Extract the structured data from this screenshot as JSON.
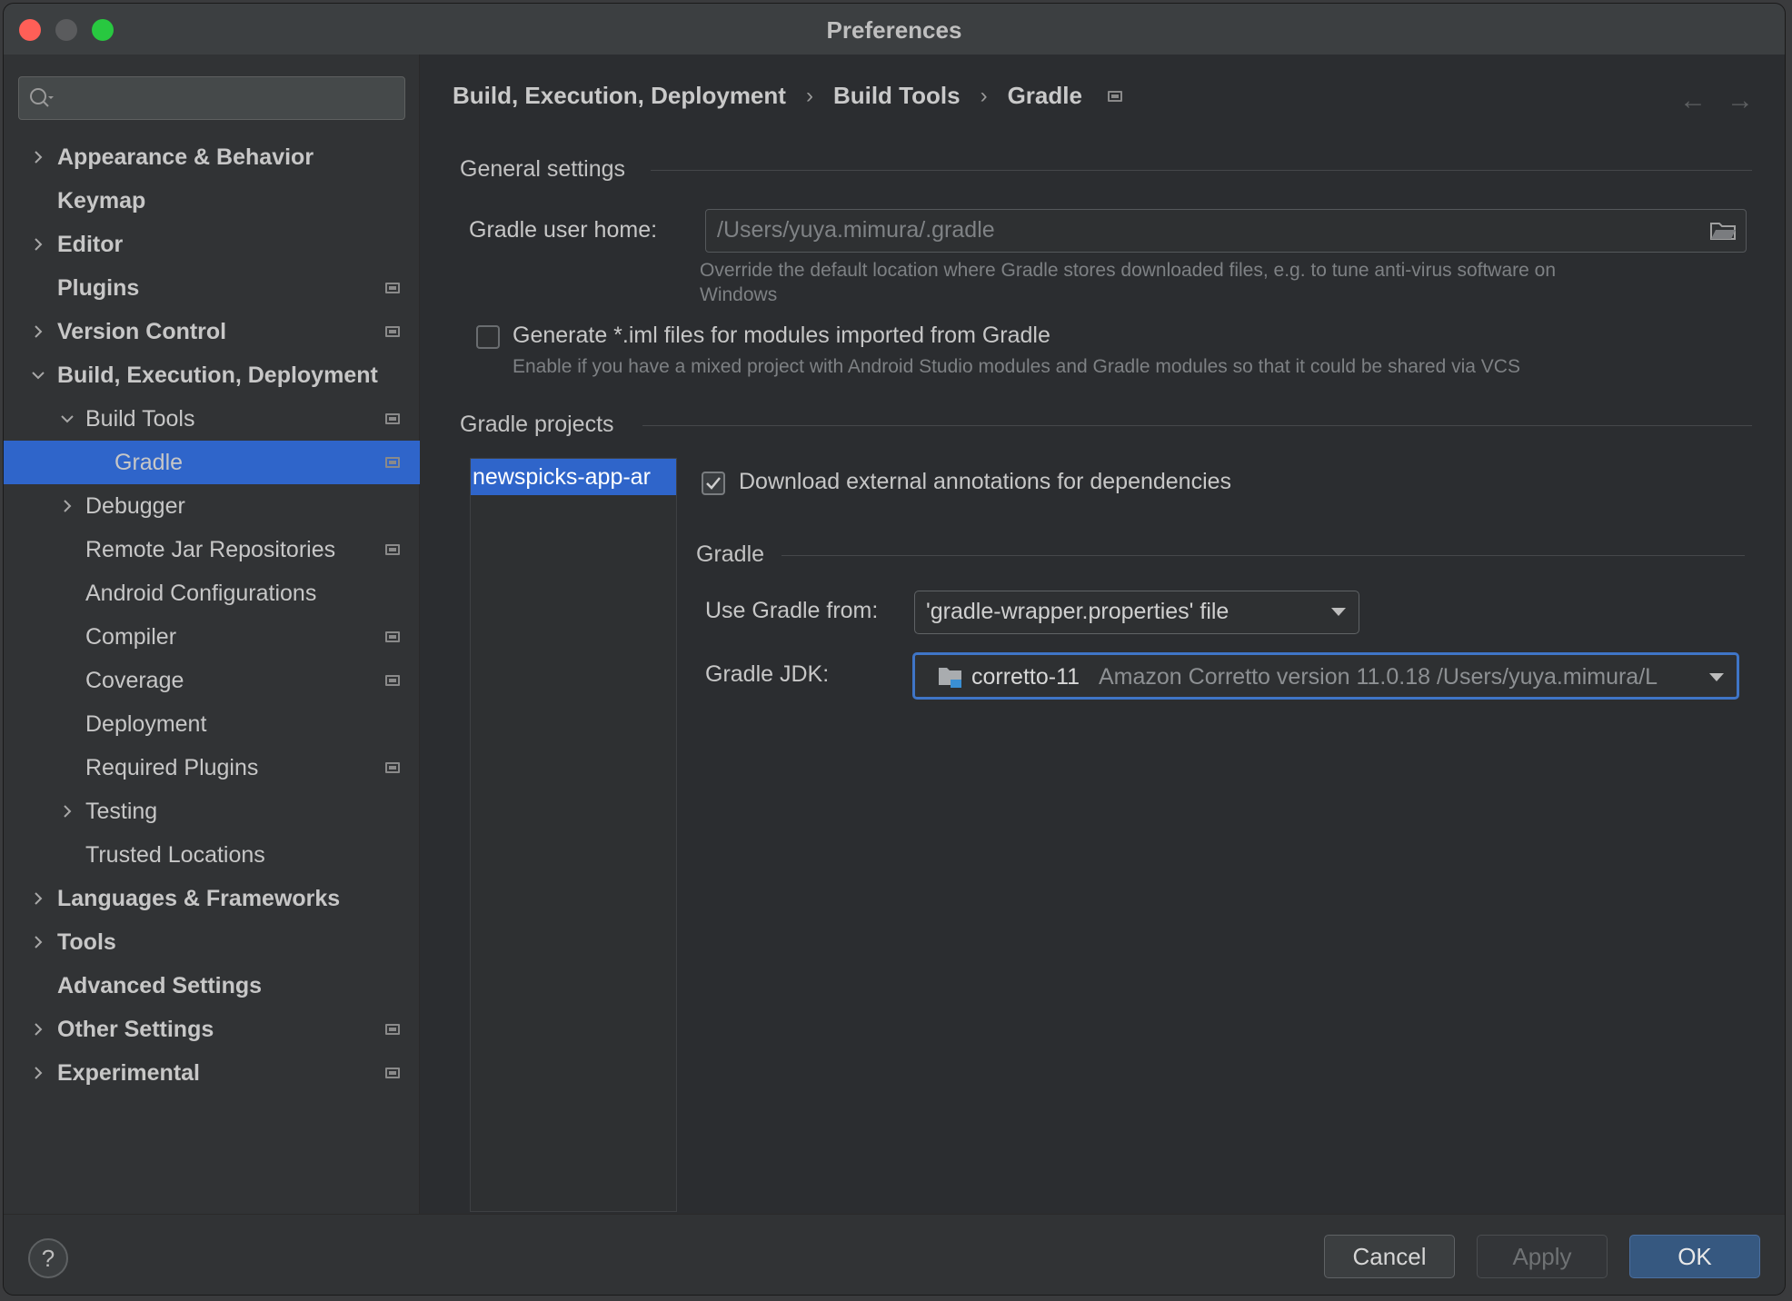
{
  "window": {
    "title": "Preferences"
  },
  "search": {
    "value": "",
    "placeholder": ""
  },
  "sidebar": {
    "items": [
      {
        "label": "Appearance & Behavior",
        "level": 0,
        "bold": true,
        "chevron": "right",
        "pin": false
      },
      {
        "label": "Keymap",
        "level": 0,
        "bold": true,
        "chevron": "none",
        "pin": false
      },
      {
        "label": "Editor",
        "level": 0,
        "bold": true,
        "chevron": "right",
        "pin": false
      },
      {
        "label": "Plugins",
        "level": 0,
        "bold": true,
        "chevron": "none",
        "pin": true
      },
      {
        "label": "Version Control",
        "level": 0,
        "bold": true,
        "chevron": "right",
        "pin": true
      },
      {
        "label": "Build, Execution, Deployment",
        "level": 0,
        "bold": true,
        "chevron": "down",
        "pin": false
      },
      {
        "label": "Build Tools",
        "level": 1,
        "bold": false,
        "chevron": "down",
        "pin": true
      },
      {
        "label": "Gradle",
        "level": 2,
        "bold": false,
        "chevron": "none",
        "pin": true,
        "selected": true
      },
      {
        "label": "Debugger",
        "level": 1,
        "bold": false,
        "chevron": "right",
        "pin": false
      },
      {
        "label": "Remote Jar Repositories",
        "level": 1,
        "bold": false,
        "chevron": "none",
        "pin": true
      },
      {
        "label": "Android Configurations",
        "level": 1,
        "bold": false,
        "chevron": "none",
        "pin": false
      },
      {
        "label": "Compiler",
        "level": 1,
        "bold": false,
        "chevron": "none",
        "pin": true
      },
      {
        "label": "Coverage",
        "level": 1,
        "bold": false,
        "chevron": "none",
        "pin": true
      },
      {
        "label": "Deployment",
        "level": 1,
        "bold": false,
        "chevron": "none",
        "pin": false
      },
      {
        "label": "Required Plugins",
        "level": 1,
        "bold": false,
        "chevron": "none",
        "pin": true
      },
      {
        "label": "Testing",
        "level": 1,
        "bold": false,
        "chevron": "right",
        "pin": false
      },
      {
        "label": "Trusted Locations",
        "level": 1,
        "bold": false,
        "chevron": "none",
        "pin": false
      },
      {
        "label": "Languages & Frameworks",
        "level": 0,
        "bold": true,
        "chevron": "right",
        "pin": false
      },
      {
        "label": "Tools",
        "level": 0,
        "bold": true,
        "chevron": "right",
        "pin": false
      },
      {
        "label": "Advanced Settings",
        "level": 0,
        "bold": true,
        "chevron": "none",
        "pin": false
      },
      {
        "label": "Other Settings",
        "level": 0,
        "bold": true,
        "chevron": "right",
        "pin": true
      },
      {
        "label": "Experimental",
        "level": 0,
        "bold": true,
        "chevron": "right",
        "pin": true
      }
    ]
  },
  "breadcrumb": {
    "items": [
      "Build, Execution, Deployment",
      "Build Tools",
      "Gradle"
    ],
    "separator": "›",
    "back_icon": "arrow-left-icon",
    "forward_icon": "arrow-right-icon"
  },
  "general": {
    "title": "General settings",
    "user_home_label": "Gradle user home:",
    "user_home_value": "/Users/yuya.mimura/.gradle",
    "user_home_hint": "Override the default location where Gradle stores downloaded files, e.g. to tune anti-virus software on",
    "user_home_hint_2": "Windows",
    "iml_label": "Generate *.iml files for modules imported from Gradle",
    "iml_checked": false,
    "iml_hint": "Enable if you have a mixed project with Android Studio modules and Gradle modules so that it could be shared via VCS"
  },
  "projects": {
    "title": "Gradle projects",
    "list": [
      "newspicks-app-ar"
    ],
    "download_label": "Download external annotations for dependencies",
    "download_checked": true,
    "gradle_title": "Gradle",
    "use_from_label": "Use Gradle from:",
    "use_from_value": "'gradle-wrapper.properties' file",
    "jdk_label": "Gradle JDK:",
    "jdk_name": "corretto-11",
    "jdk_detail": "Amazon Corretto version 11.0.18 /Users/yuya.mimura/L"
  },
  "footer": {
    "help_label": "?",
    "cancel": "Cancel",
    "apply": "Apply",
    "ok": "OK"
  },
  "colors": {
    "selection": "#2f65ca",
    "primary_button": "#365880",
    "focus_ring": "#3f75c7"
  }
}
